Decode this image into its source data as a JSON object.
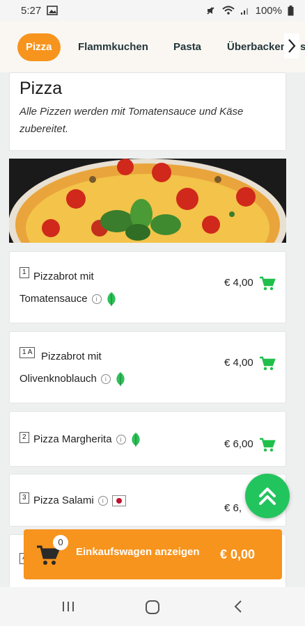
{
  "status": {
    "time": "5:27",
    "battery": "100%"
  },
  "tabs": [
    {
      "label": "Pizza",
      "active": true
    },
    {
      "label": "Flammkuchen",
      "active": false
    },
    {
      "label": "Pasta",
      "active": false
    },
    {
      "label": "Überbacken",
      "active": false
    },
    {
      "label": "s",
      "active": false
    }
  ],
  "category": {
    "title": "Pizza",
    "description": "Alle Pizzen werden mit Tomatensauce und Käse zubereitet."
  },
  "products": [
    {
      "number": "1",
      "name_line1": "Pizzabrot mit",
      "name_line2": "Tomatensauce",
      "price": "€ 4,00",
      "badge": "vegetarian-leaf-icon"
    },
    {
      "number": "1 A",
      "name_line1": "Pizzabrot mit",
      "name_line2": "Olivenknoblauch",
      "price": "€ 4,00",
      "badge": "vegetarian-leaf-icon"
    },
    {
      "number": "2",
      "name_line1": "Pizza Margherita",
      "name_line2": "",
      "price": "€ 6,00",
      "badge": "vegetarian-leaf-icon"
    },
    {
      "number": "3",
      "name_line1": "Pizza Salami",
      "name_line2": "",
      "price": "€ 6,",
      "badge": "japan-flag-icon"
    },
    {
      "number": "4",
      "name_line1": "",
      "name_line2": "",
      "price": "",
      "badge": ""
    }
  ],
  "cart": {
    "count": "0",
    "label": "Einkaufswagen anzeigen",
    "total": "€ 0,00"
  },
  "colors": {
    "accent": "#f7941d",
    "green": "#22c45e",
    "cart_icon": "#1fbf4a"
  }
}
